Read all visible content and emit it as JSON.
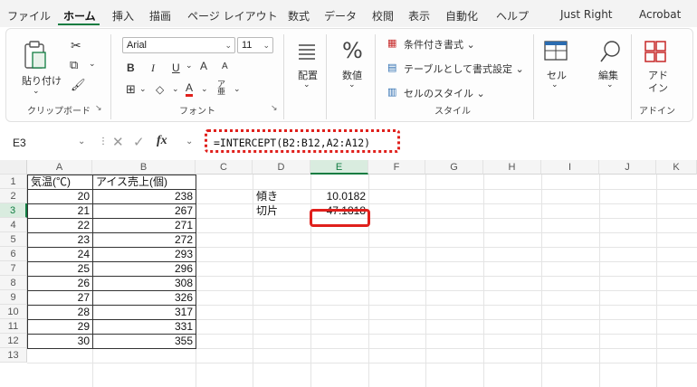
{
  "menu": {
    "tabs": [
      "ファイル",
      "ホーム",
      "挿入",
      "描画",
      "ページ レイアウト",
      "数式",
      "データ",
      "校閲",
      "表示",
      "自動化",
      "ヘルプ",
      "Just Right",
      "Acrobat"
    ],
    "active_tab": "ホーム"
  },
  "ribbon": {
    "clipboard": {
      "paste_label": "貼り付け",
      "group_label": "クリップボード"
    },
    "font": {
      "font_name": "Arial",
      "font_size": "11",
      "bold": "B",
      "italic": "I",
      "underline": "U",
      "grow": "A",
      "shrink": "A",
      "color_a": "A",
      "group_label": "フォント"
    },
    "alignment": {
      "label": "配置"
    },
    "number": {
      "label": "数値",
      "symbol": "%"
    },
    "styles": {
      "conditional": "条件付き書式 ⌄",
      "table": "テーブルとして書式設定 ⌄",
      "cell_styles": "セルのスタイル ⌄",
      "group_label": "スタイル"
    },
    "cells": {
      "label": "セル"
    },
    "editing": {
      "label": "編集"
    },
    "addins": {
      "label_line1": "アド",
      "label_line2": "イン",
      "group_label": "アドイン"
    }
  },
  "formula_bar": {
    "name_box": "E3",
    "fx": "fx",
    "formula": "=INTERCEPT(B2:B12,A2:A12)"
  },
  "sheet": {
    "columns": [
      "A",
      "B",
      "C",
      "D",
      "E",
      "F",
      "G",
      "H",
      "I",
      "J",
      "K"
    ],
    "rows": [
      "1",
      "2",
      "3",
      "4",
      "5",
      "6",
      "7",
      "8",
      "9",
      "10",
      "11",
      "12",
      "13"
    ],
    "headers": {
      "a1": "気温(℃)",
      "b1": "アイス売上(個)"
    },
    "temperature": [
      "20",
      "21",
      "22",
      "23",
      "24",
      "25",
      "26",
      "27",
      "28",
      "29",
      "30"
    ],
    "sales": [
      "238",
      "267",
      "271",
      "272",
      "293",
      "296",
      "308",
      "326",
      "317",
      "331",
      "355"
    ],
    "labels": {
      "slope": "傾き",
      "intercept": "切片"
    },
    "values": {
      "slope": "10.0182",
      "intercept": "47.1818"
    }
  },
  "colors": {
    "accent": "#107c41",
    "highlight": "#e0201c"
  }
}
